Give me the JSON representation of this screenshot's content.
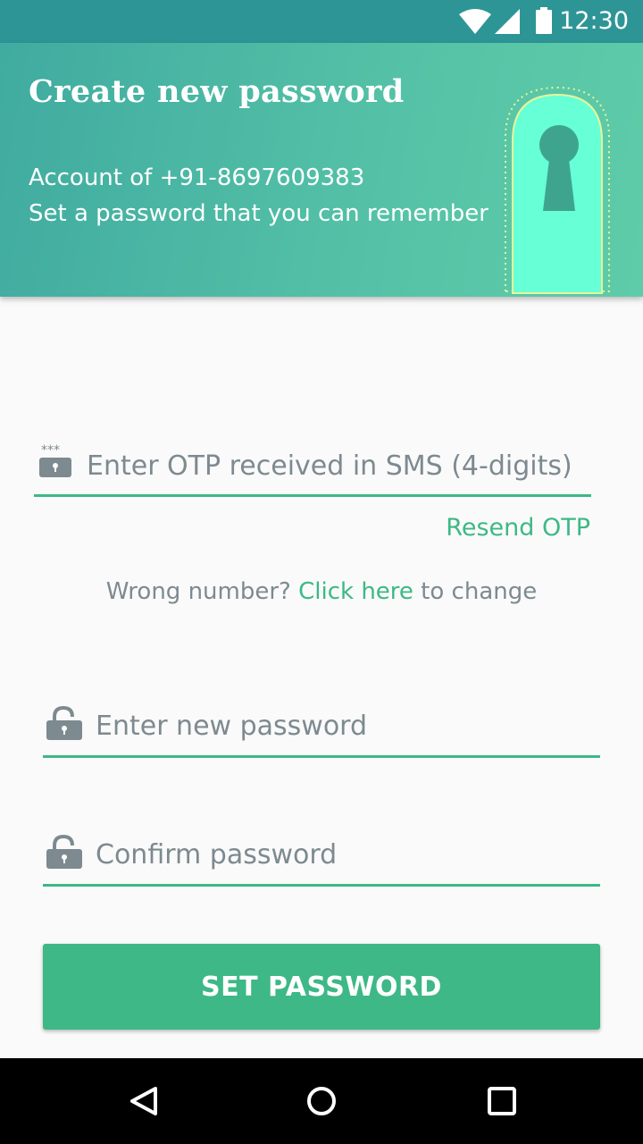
{
  "status_bar": {
    "time": "12:30",
    "icons": [
      "wifi-icon",
      "signal-icon",
      "battery-icon"
    ]
  },
  "header": {
    "title": "Create new password",
    "account_line": "Account of +91-8697609383",
    "hint_line": "Set a password that you can remember",
    "illustration": "keyhole-door-icon"
  },
  "otp": {
    "placeholder": "Enter OTP received in SMS (4-digits)",
    "icon": "otp-lock-icon",
    "resend_label": "Resend OTP"
  },
  "wrong_number": {
    "prefix": "Wrong number? ",
    "link": "Click here",
    "suffix": " to change"
  },
  "new_password": {
    "placeholder": "Enter new password",
    "icon": "unlocked-padlock-icon"
  },
  "confirm_password": {
    "placeholder": "Confirm password",
    "icon": "unlocked-padlock-icon"
  },
  "submit": {
    "label": "SET PASSWORD"
  },
  "nav_bar": {
    "buttons": [
      "back-icon",
      "home-icon",
      "recents-icon"
    ]
  },
  "colors": {
    "accent": "#3db886",
    "status_bar": "#2e9596",
    "header_start": "#40aba0",
    "header_end": "#5ecca8",
    "placeholder_text": "#7d8a90"
  }
}
